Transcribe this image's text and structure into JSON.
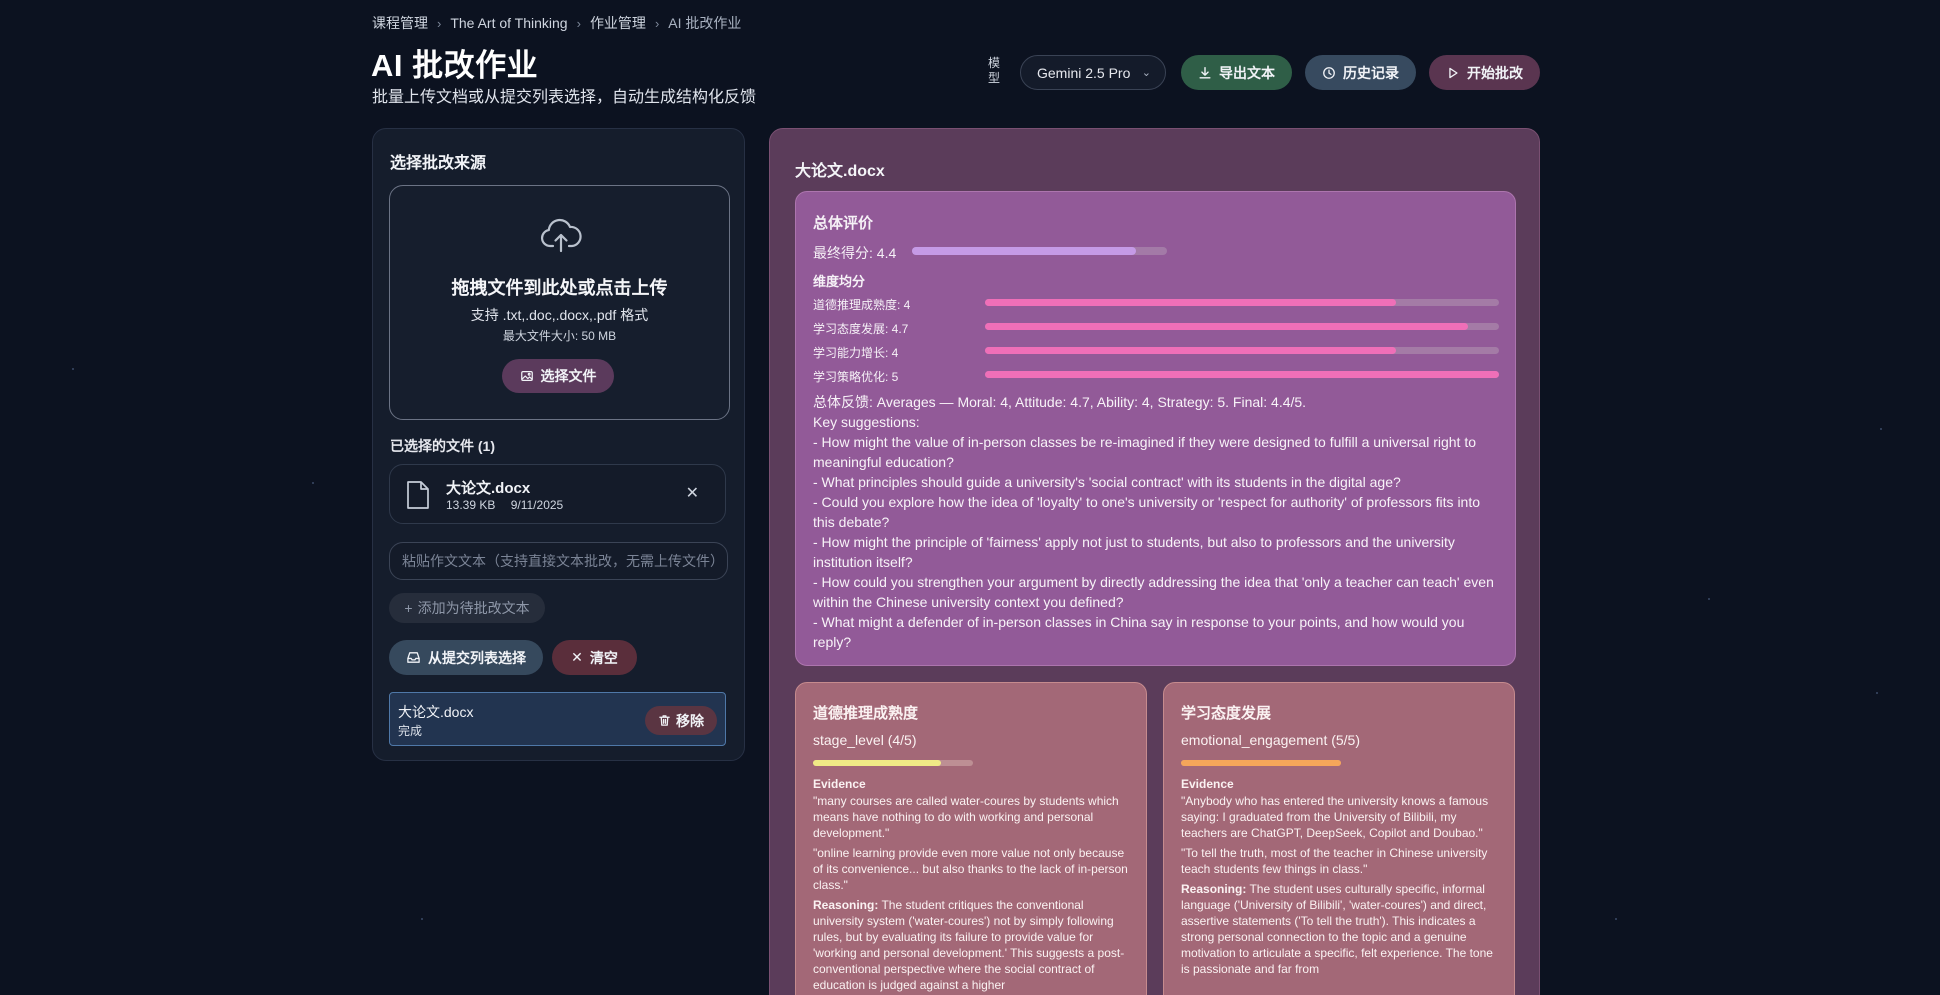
{
  "breadcrumb": [
    "课程管理",
    "The Art of Thinking",
    "作业管理",
    "AI 批改作业"
  ],
  "header": {
    "title": "AI 批改作业",
    "subtitle": "批量上传文档或从提交列表选择，自动生成结构化反馈",
    "model_label": "模型",
    "model_value": "Gemini 2.5 Pro",
    "export_label": "导出文本",
    "history_label": "历史记录",
    "start_label": "开始批改"
  },
  "left": {
    "title": "选择批改来源",
    "dropzone": {
      "main": "拖拽文件到此处或点击上传",
      "formats": "支持 .txt,.doc,.docx,.pdf 格式",
      "max_size": "最大文件大小: 50 MB",
      "choose_label": "选择文件"
    },
    "selected_label": "已选择的文件 (1)",
    "file": {
      "name": "大论文.docx",
      "size": "13.39 KB",
      "date": "9/11/2025"
    },
    "paste_placeholder": "粘贴作文文本（支持直接文本批改，无需上传文件）",
    "add_text_label": "添加为待批改文本",
    "from_list_label": "从提交列表选择",
    "clear_label": "清空",
    "queue": {
      "name": "大论文.docx",
      "status": "完成",
      "remove_label": "移除"
    }
  },
  "right": {
    "file_title": "大论文.docx",
    "overall": {
      "title": "总体评价",
      "final_score_label": "最终得分: 4.4",
      "final_score_fraction": 0.88,
      "dims_title": "维度均分",
      "dims": [
        {
          "label": "道德推理成熟度: 4",
          "fraction": 0.8
        },
        {
          "label": "学习态度发展: 4.7",
          "fraction": 0.94
        },
        {
          "label": "学习能力增长: 4",
          "fraction": 0.8
        },
        {
          "label": "学习策略优化: 5",
          "fraction": 1.0
        }
      ],
      "feedback": [
        "总体反馈: Averages — Moral: 4, Attitude: 4.7, Ability: 4, Strategy: 5. Final: 4.4/5.",
        "Key suggestions:",
        "- How might the value of in-person classes be re-imagined if they were designed to fulfill a universal right to meaningful education?",
        "- What principles should guide a university's 'social contract' with its students in the digital age?",
        "- Could you explore how the idea of 'loyalty' to one's university or 'respect for authority' of professors fits into this debate?",
        "- How might the principle of 'fairness' apply not just to students, but also to professors and the university institution itself?",
        "- How could you strengthen your argument by directly addressing the idea that 'only a teacher can teach' even within the Chinese university context you defined?",
        "- What might a defender of in-person classes in China say in response to your points, and how would you reply?"
      ]
    },
    "cards": [
      {
        "title": "道德推理成熟度",
        "metric": "stage_level (4/5)",
        "fraction": 0.8,
        "evidence_label": "Evidence",
        "quotes": [
          "\"many courses are called water-coures by students which means have nothing to do with working and personal development.\"",
          "\"online learning provide even more value not only because of its convenience... but also thanks to the lack of in-person class.\""
        ],
        "reasoning_label": "Reasoning:",
        "reasoning": "The student critiques the conventional university system ('water-coures') not by simply following rules, but by evaluating its failure to provide value for 'working and personal development.' This suggests a post-conventional perspective where the social contract of education is judged against a higher"
      },
      {
        "title": "学习态度发展",
        "metric": "emotional_engagement (5/5)",
        "fraction": 1.0,
        "evidence_label": "Evidence",
        "quotes": [
          "\"Anybody who has entered the university knows a famous saying: I graduated from the University of Bilibili, my teachers are ChatGPT, DeepSeek, Copilot and Doubao.\"",
          "\"To tell the truth, most of the teacher in Chinese university teach students few things in class.\""
        ],
        "reasoning_label": "Reasoning:",
        "reasoning": "The student uses culturally specific, informal language ('University of Bilibili', 'water-coures') and direct, assertive statements ('To tell the truth'). This indicates a strong personal connection to the topic and a genuine motivation to articulate a specific, felt experience. The tone is passionate and far from"
      }
    ]
  }
}
